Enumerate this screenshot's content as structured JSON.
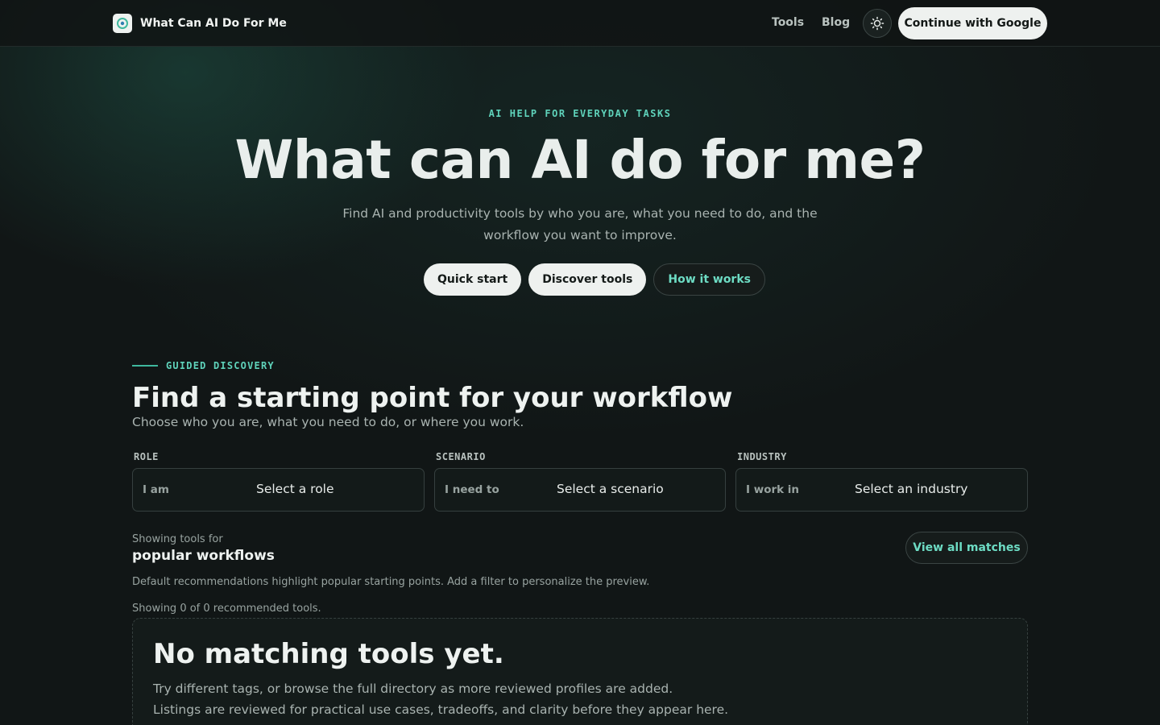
{
  "header": {
    "brand": "What Can AI Do For Me",
    "nav": [
      {
        "label": "Tools"
      },
      {
        "label": "Blog"
      }
    ],
    "theme_icon": "sun-icon",
    "cta_label": "Continue with Google"
  },
  "hero": {
    "eyebrow": "AI HELP FOR EVERYDAY TASKS",
    "title": "What can AI do for me?",
    "subtitle": "Find AI and productivity tools by who you are, what you need to do, and the workflow you want to improve.",
    "actions": [
      {
        "label": "Quick start"
      },
      {
        "label": "Discover tools"
      },
      {
        "label": "How it works"
      }
    ]
  },
  "discovery": {
    "eyebrow": "GUIDED DISCOVERY",
    "title": "Find a starting point for your workflow",
    "subtitle": "Choose who you are, what you need to do, or where you work.",
    "filters": [
      {
        "label": "ROLE",
        "prefix": "I am",
        "value": "Select a role"
      },
      {
        "label": "SCENARIO",
        "prefix": "I need to",
        "value": "Select a scenario"
      },
      {
        "label": "INDUSTRY",
        "prefix": "I work in",
        "value": "Select an industry"
      }
    ],
    "showing_for": "Showing tools for",
    "showing_target": "popular workflows",
    "view_all_label": "View all matches",
    "default_note": "Default recommendations highlight popular starting points. Add a filter to personalize the preview.",
    "count_note": "Showing 0 of 0 recommended tools."
  },
  "empty_state": {
    "title": "No matching tools yet.",
    "line1": "Try different tags, or browse the full directory as more reviewed profiles are added.",
    "line2": "Listings are reviewed for practical use cases, tradeoffs, and clarity before they appear here."
  },
  "colors": {
    "accent": "#5fd3bb",
    "background": "#111616",
    "button_light": "#eef1ef"
  }
}
